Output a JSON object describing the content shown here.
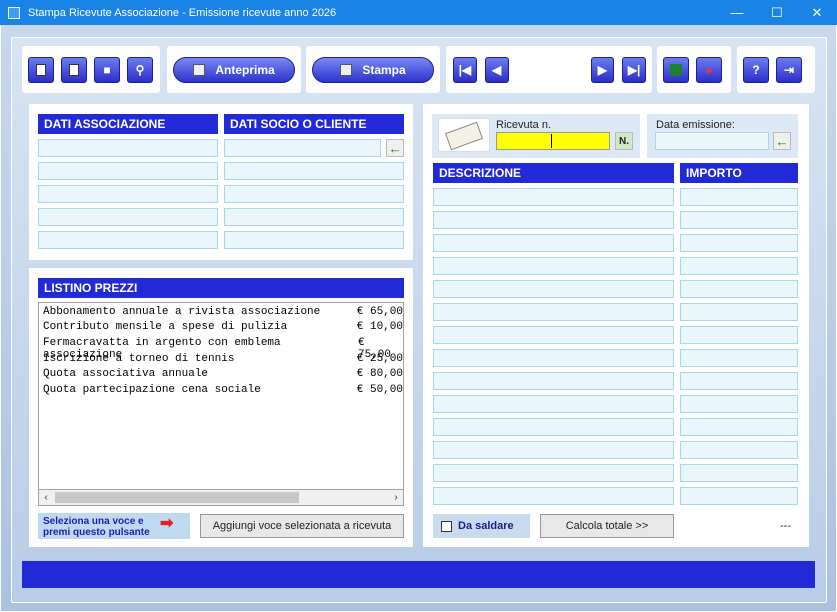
{
  "window": {
    "title": "Stampa Ricevute Associazione - Emissione ricevute anno 2026",
    "minimize": "—",
    "maximize": "☐",
    "close": "✕"
  },
  "toolbar": {
    "preview_label": "Anteprima",
    "print_label": "Stampa"
  },
  "left": {
    "assoc_header": "DATI ASSOCIAZIONE",
    "member_header": "DATI SOCIO O CLIENTE",
    "assoc_fields": [
      "",
      "",
      "",
      "",
      ""
    ],
    "member_fields": [
      "",
      "",
      "",
      "",
      ""
    ]
  },
  "price_list": {
    "header": "LISTINO PREZZI",
    "items": [
      {
        "name": "Abbonamento annuale a rivista associazione",
        "price": "€ 65,00"
      },
      {
        "name": "Contributo mensile a spese di pulizia",
        "price": "€ 10,00"
      },
      {
        "name": "Fermacravatta in argento con emblema associazione",
        "price": "€ 75,00"
      },
      {
        "name": "Iscrizione a torneo di tennis",
        "price": "€ 25,00"
      },
      {
        "name": "Quota associativa annuale",
        "price": "€ 80,00"
      },
      {
        "name": "Quota partecipazione cena sociale",
        "price": "€ 50,00"
      }
    ],
    "hint_line1": "Seleziona una voce e",
    "hint_line2": "premi questo pulsante",
    "add_button": "Aggiungi voce selezionata a ricevuta"
  },
  "receipt": {
    "number_label": "Ricevuta n.",
    "number_value": "",
    "date_label": "Data emissione:",
    "date_value": "",
    "desc_header": "DESCRIZIONE",
    "amount_header": "IMPORTO",
    "to_pay_label": "Da saldare",
    "to_pay_checked": false,
    "total_button": "Calcola totale  >>",
    "total_value": "---"
  }
}
